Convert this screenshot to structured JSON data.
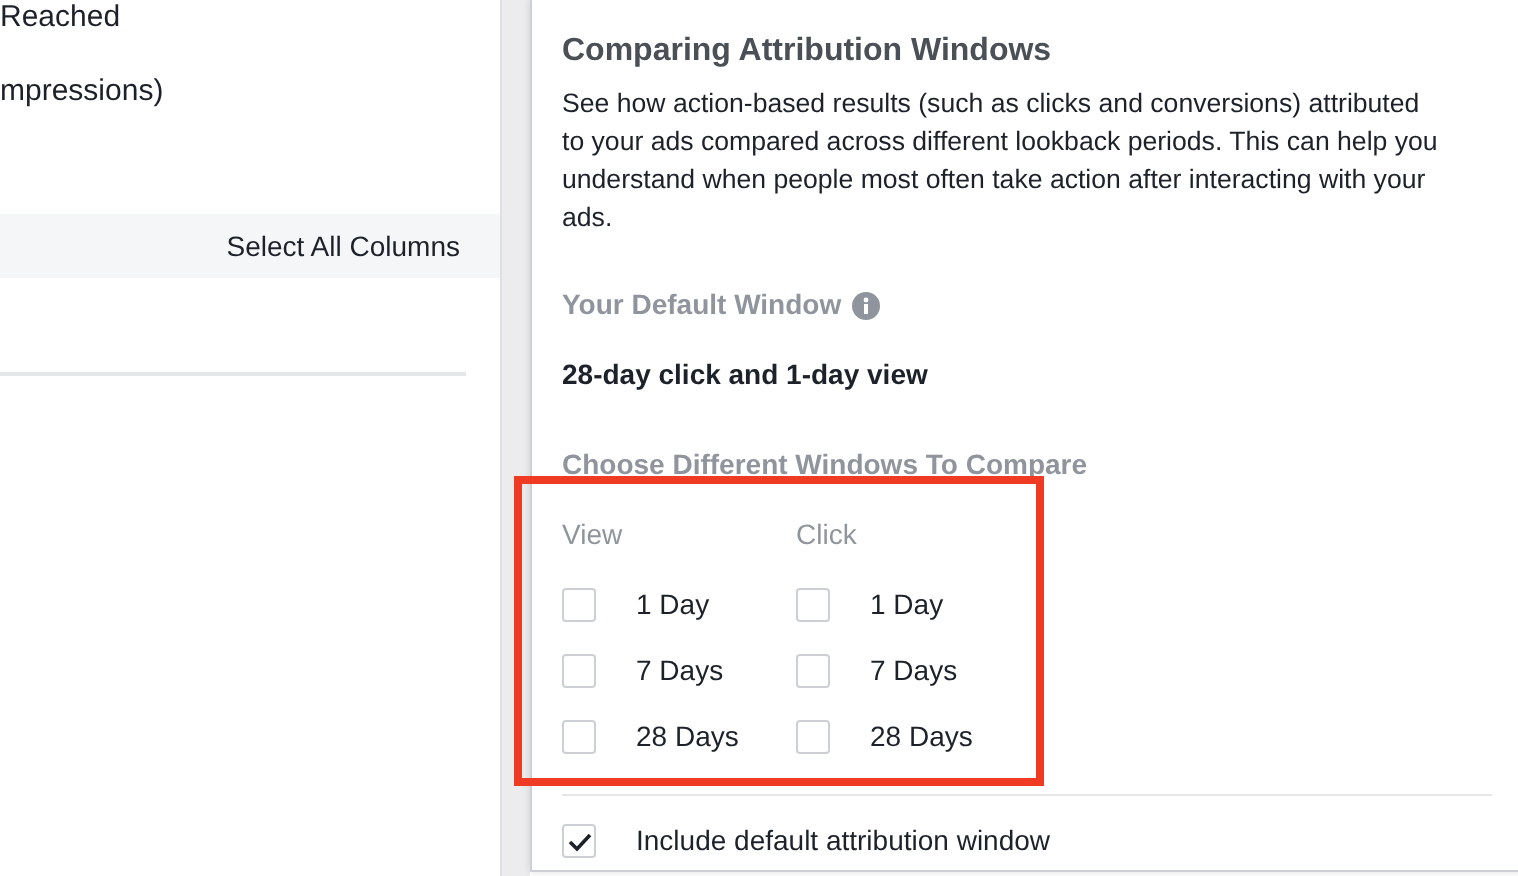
{
  "left_panel": {
    "items": [
      {
        "label": "Reached"
      },
      {
        "label": "mpressions)"
      }
    ],
    "select_all": "Select All Columns"
  },
  "popover": {
    "title": "Comparing Attribution Windows",
    "description": "See how action-based results (such as clicks and conversions) attributed to your ads compared across different lookback periods. This can help you understand when people most often take action after interacting with your ads.",
    "default_label": "Your Default Window",
    "default_value": "28-day click and 1-day view",
    "compare_label": "Choose Different Windows To Compare",
    "groups": [
      {
        "label": "View",
        "options": [
          {
            "label": "1 Day",
            "checked": false
          },
          {
            "label": "7 Days",
            "checked": false
          },
          {
            "label": "28 Days",
            "checked": false
          }
        ]
      },
      {
        "label": "Click",
        "options": [
          {
            "label": "1 Day",
            "checked": false
          },
          {
            "label": "7 Days",
            "checked": false
          },
          {
            "label": "28 Days",
            "checked": false
          }
        ]
      }
    ],
    "include": {
      "label": "Include default attribution window",
      "checked": true
    }
  }
}
